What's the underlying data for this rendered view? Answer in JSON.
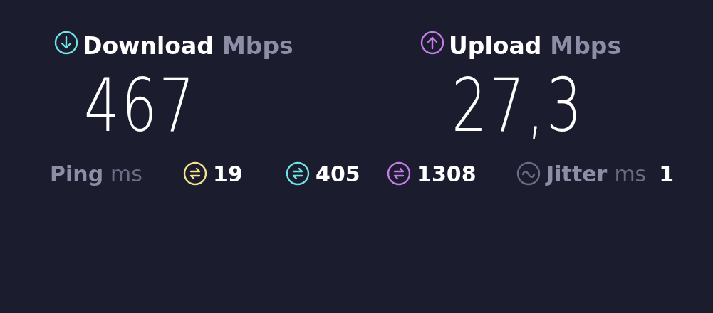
{
  "download": {
    "label": "Download",
    "unit": "Mbps",
    "value": "467"
  },
  "upload": {
    "label": "Upload",
    "unit": "Mbps",
    "value": "27,3"
  },
  "ping": {
    "label": "Ping",
    "unit": "ms",
    "readings": [
      {
        "value": "19",
        "color": "#f3e38c"
      },
      {
        "value": "405",
        "color": "#6fe3e3"
      },
      {
        "value": "1308",
        "color": "#c47be6"
      }
    ]
  },
  "jitter": {
    "label": "Jitter",
    "unit": "ms",
    "value": "1"
  }
}
